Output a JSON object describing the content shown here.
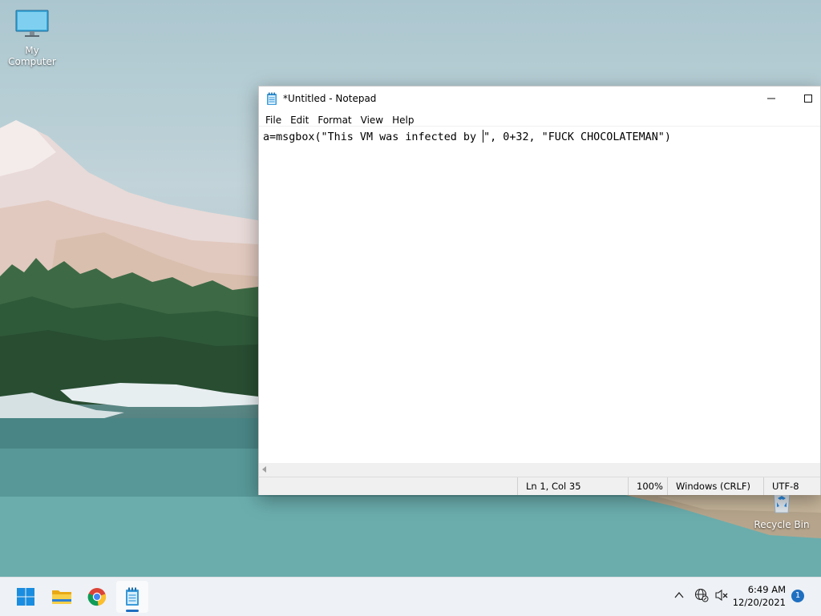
{
  "desktop": {
    "icons": [
      {
        "label": "My Computer",
        "icon": "monitor-icon"
      },
      {
        "label": "Recycle Bin",
        "icon": "recycle-bin-icon"
      }
    ]
  },
  "notepad": {
    "title": "*Untitled - Notepad",
    "menu": [
      "File",
      "Edit",
      "Format",
      "View",
      "Help"
    ],
    "text_before_caret": "a=msgbox(\"This VM was infected by ",
    "text_after_caret": "\", 0+32, \"FUCK CHOCOLATEMAN\")",
    "status": {
      "position": "Ln 1, Col 35",
      "zoom": "100%",
      "line_ending": "Windows (CRLF)",
      "encoding": "UTF-8"
    }
  },
  "taskbar": {
    "apps": [
      "start-icon",
      "file-explorer-icon",
      "chrome-icon",
      "notepad-icon"
    ],
    "clock_time": "6:49 AM",
    "clock_date": "12/20/2021",
    "notification_count": "1",
    "accent_color": "#1f6fc0"
  }
}
